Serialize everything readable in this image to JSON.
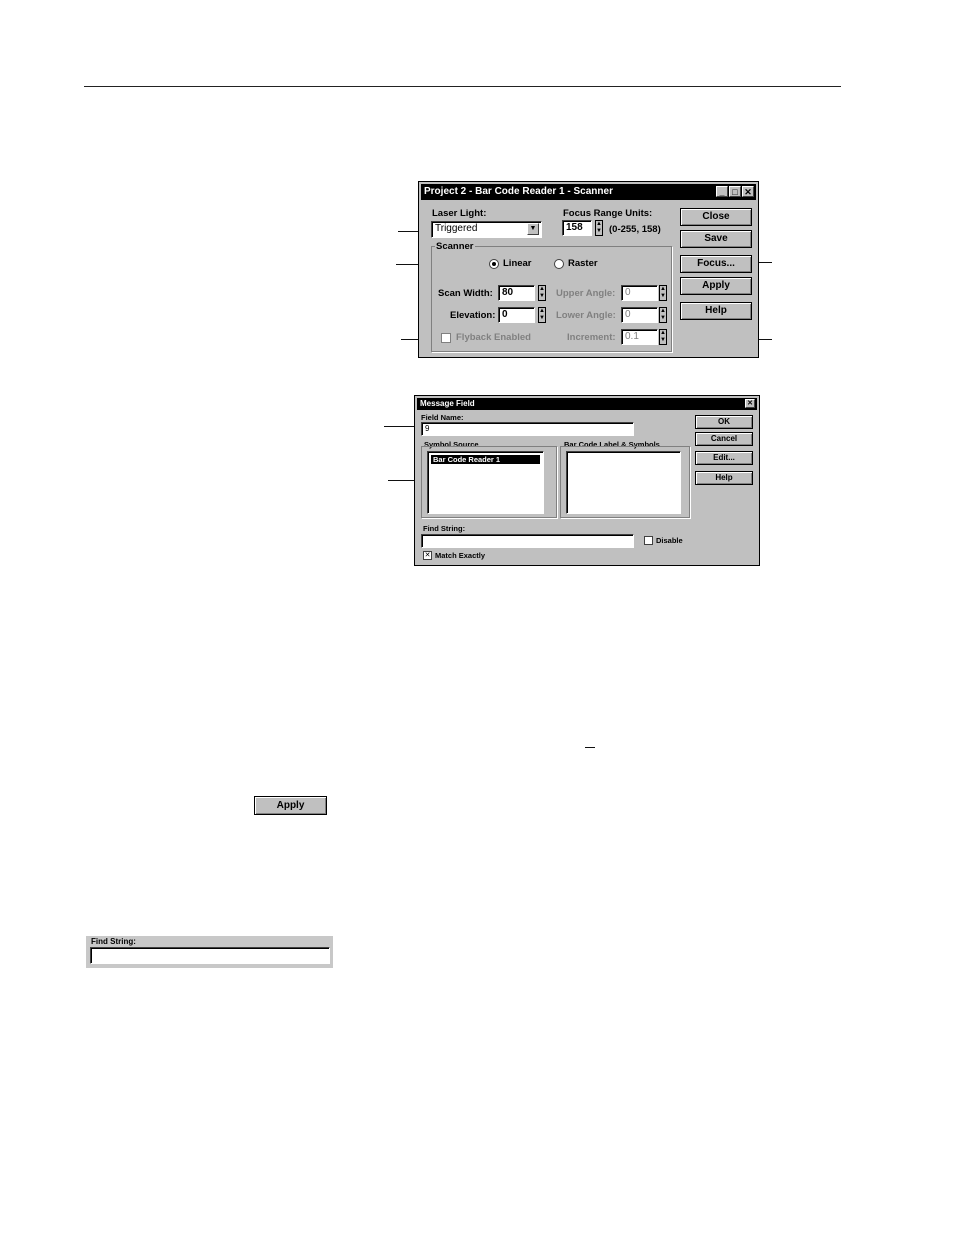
{
  "scanner_dialog": {
    "title": "Project 2 - Bar Code Reader 1 - Scanner",
    "title_buttons": {
      "minimize": "_",
      "maximize": "□",
      "close": "✕"
    },
    "laser_light": {
      "label": "Laser Light:",
      "value": "Triggered"
    },
    "focus_range": {
      "label": "Focus Range Units:",
      "value": "158",
      "range_text": "(0-255, 158)"
    },
    "scanner_group": {
      "label": "Scanner",
      "linear": {
        "label": "Linear",
        "selected": true
      },
      "raster": {
        "label": "Raster",
        "selected": false
      },
      "scan_width": {
        "label": "Scan Width:",
        "value": "80"
      },
      "elevation": {
        "label": "Elevation:",
        "value": "0"
      },
      "upper_angle": {
        "label": "Upper Angle:",
        "value": "0"
      },
      "lower_angle": {
        "label": "Lower Angle:",
        "value": "0"
      },
      "increment": {
        "label": "Increment:",
        "value": "0.1"
      },
      "flyback": {
        "label": "Flyback Enabled",
        "checked": false
      }
    },
    "buttons": {
      "close": "Close",
      "save": "Save",
      "focus": "Focus...",
      "apply": "Apply",
      "help": "Help"
    }
  },
  "message_dialog": {
    "title": "Message Field",
    "close": "✕",
    "field_name": {
      "label": "Field Name:",
      "value": "9"
    },
    "symbol_source": {
      "label": "Symbol Source",
      "items": [
        "Bar Code Reader 1"
      ]
    },
    "bar_code_label": {
      "label": "Bar Code Label & Symbols",
      "items": []
    },
    "find_string": {
      "label": "Find String:",
      "value": ""
    },
    "disable": {
      "label": "Disable",
      "checked": false
    },
    "match_exactly": {
      "label": "Match Exactly",
      "checked": true,
      "mark": "✕"
    },
    "buttons": {
      "ok": "OK",
      "cancel": "Cancel",
      "edit": "Edit...",
      "help": "Help"
    }
  },
  "inline_figures": {
    "apply_button": "Apply",
    "find_string_label": "Find String:"
  },
  "icons": {
    "spin_up": "▲",
    "spin_down": "▼",
    "combo_arrow": "▼"
  }
}
